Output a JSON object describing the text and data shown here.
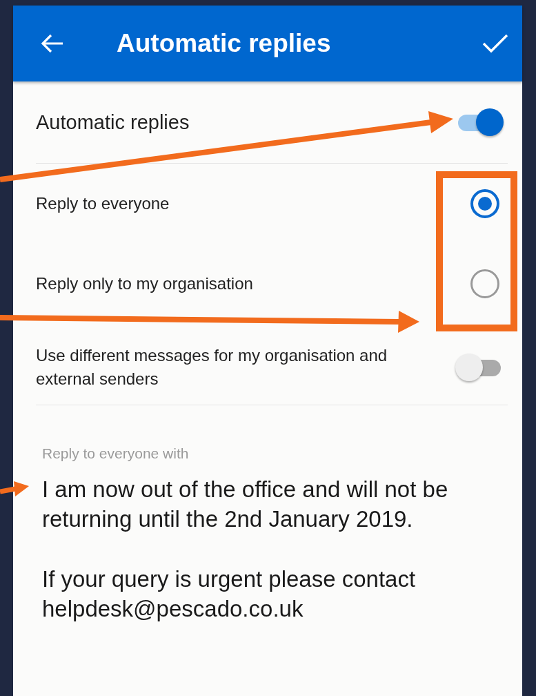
{
  "header": {
    "title": "Automatic replies"
  },
  "settings": [
    {
      "kind": "toggle",
      "label": "Automatic replies",
      "on": true
    },
    {
      "kind": "radio",
      "label": "Reply to everyone",
      "selected": true
    },
    {
      "kind": "radio",
      "label": "Reply only to my organisation",
      "selected": false
    },
    {
      "kind": "toggle",
      "label": "Use different messages for my organisation and external senders",
      "on": false
    }
  ],
  "message": {
    "label": "Reply to everyone with",
    "paragraphs": [
      "I am now out of the office and will not be returning until the 2nd January 2019.",
      "If your query is urgent please contact helpdesk@pescado.co.uk"
    ]
  }
}
